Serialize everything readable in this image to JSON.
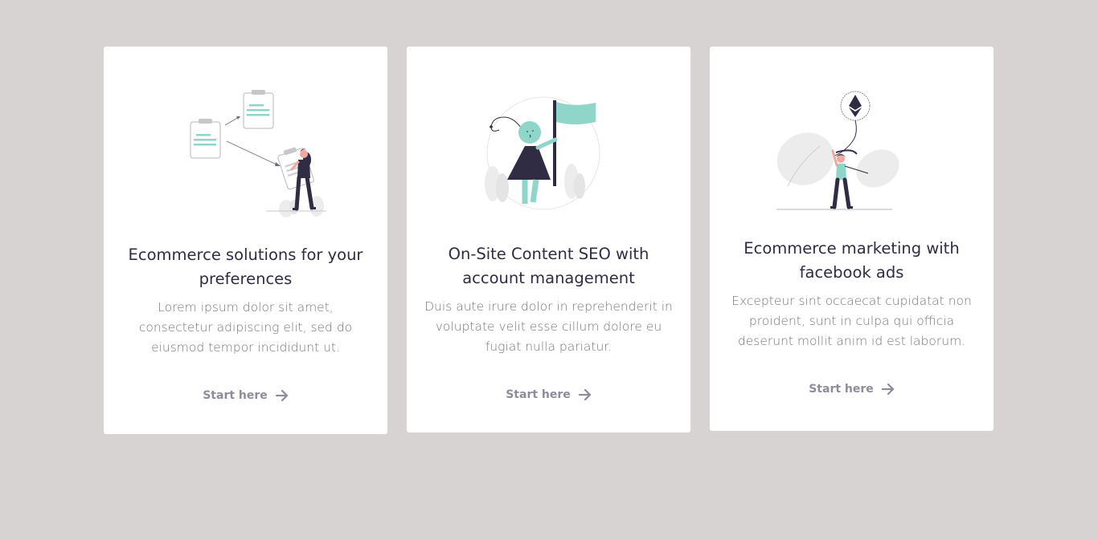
{
  "cards": [
    {
      "illustration": "clipboard-tasks-woman-illustration",
      "title": "Ecommerce solutions for your preferences",
      "description": "Lorem ipsum dolor sit amet, consectetur adipiscing elit, sed do eiusmod tempor incididunt ut.",
      "link_label": "Start here",
      "link_icon": "arrow-right-icon"
    },
    {
      "illustration": "flag-person-illustration",
      "title": "On-Site Content SEO with account management",
      "description": "Duis aute irure dolor in reprehenderit in voluptate velit esse cillum dolore eu fugiat nulla pariatur.",
      "link_label": "Start here",
      "link_icon": "arrow-right-icon"
    },
    {
      "illustration": "ethereum-balloon-woman-illustration",
      "title": "Ecommerce marketing with facebook ads",
      "description": "Excepteur sint occaecat cupidatat non proident, sunt in culpa qui officia deserunt mollit anim id est laborum.",
      "link_label": "Start here",
      "link_icon": "arrow-right-icon"
    }
  ],
  "colors": {
    "background": "#d7d3d2",
    "card": "#ffffff",
    "accent": "#8fd5c9",
    "title": "#2f2c43",
    "body": "#7a7675",
    "link": "#8f8b9a"
  }
}
